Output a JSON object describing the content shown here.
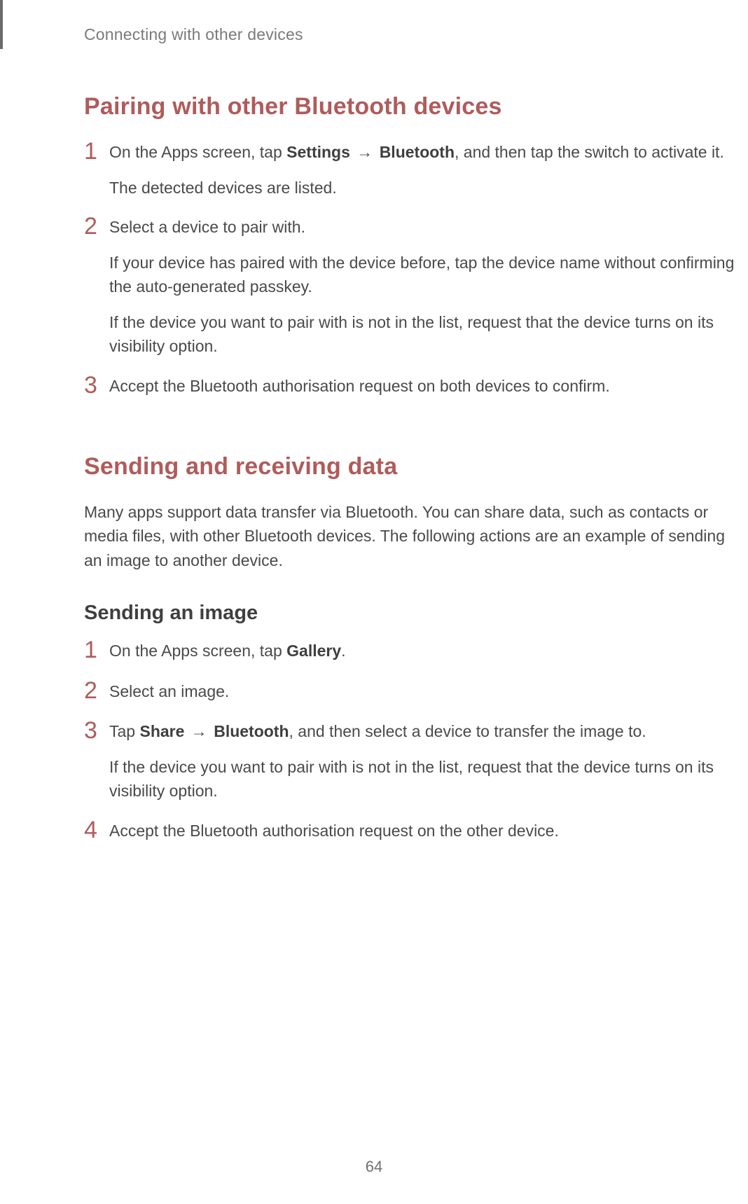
{
  "header": "Connecting with other devices",
  "page_number": "64",
  "arrow": "→",
  "section1": {
    "title": "Pairing with other Bluetooth devices",
    "steps": [
      {
        "num": "1",
        "paras": [
          {
            "runs": [
              {
                "text": "On the Apps screen, tap "
              },
              {
                "text": "Settings",
                "bold": true
              },
              {
                "text": " → ",
                "arrow": true
              },
              {
                "text": "Bluetooth",
                "bold": true
              },
              {
                "text": ", and then tap the switch to activate it."
              }
            ]
          },
          {
            "runs": [
              {
                "text": "The detected devices are listed."
              }
            ]
          }
        ]
      },
      {
        "num": "2",
        "paras": [
          {
            "runs": [
              {
                "text": "Select a device to pair with."
              }
            ]
          },
          {
            "runs": [
              {
                "text": "If your device has paired with the device before, tap the device name without confirming the auto-generated passkey."
              }
            ]
          },
          {
            "runs": [
              {
                "text": "If the device you want to pair with is not in the list, request that the device turns on its visibility option."
              }
            ]
          }
        ]
      },
      {
        "num": "3",
        "paras": [
          {
            "runs": [
              {
                "text": "Accept the Bluetooth authorisation request on both devices to confirm."
              }
            ]
          }
        ]
      }
    ]
  },
  "section2": {
    "title": "Sending and receiving data",
    "intro": "Many apps support data transfer via Bluetooth. You can share data, such as contacts or media files, with other Bluetooth devices. The following actions are an example of sending an image to another device.",
    "subheading": "Sending an image",
    "steps": [
      {
        "num": "1",
        "paras": [
          {
            "runs": [
              {
                "text": "On the Apps screen, tap "
              },
              {
                "text": "Gallery",
                "bold": true
              },
              {
                "text": "."
              }
            ]
          }
        ]
      },
      {
        "num": "2",
        "paras": [
          {
            "runs": [
              {
                "text": "Select an image."
              }
            ]
          }
        ]
      },
      {
        "num": "3",
        "paras": [
          {
            "runs": [
              {
                "text": "Tap "
              },
              {
                "text": "Share",
                "bold": true
              },
              {
                "text": " → ",
                "arrow": true
              },
              {
                "text": "Bluetooth",
                "bold": true
              },
              {
                "text": ", and then select a device to transfer the image to."
              }
            ]
          },
          {
            "runs": [
              {
                "text": "If the device you want to pair with is not in the list, request that the device turns on its visibility option."
              }
            ]
          }
        ]
      },
      {
        "num": "4",
        "paras": [
          {
            "runs": [
              {
                "text": "Accept the Bluetooth authorisation request on the other device."
              }
            ]
          }
        ]
      }
    ]
  }
}
